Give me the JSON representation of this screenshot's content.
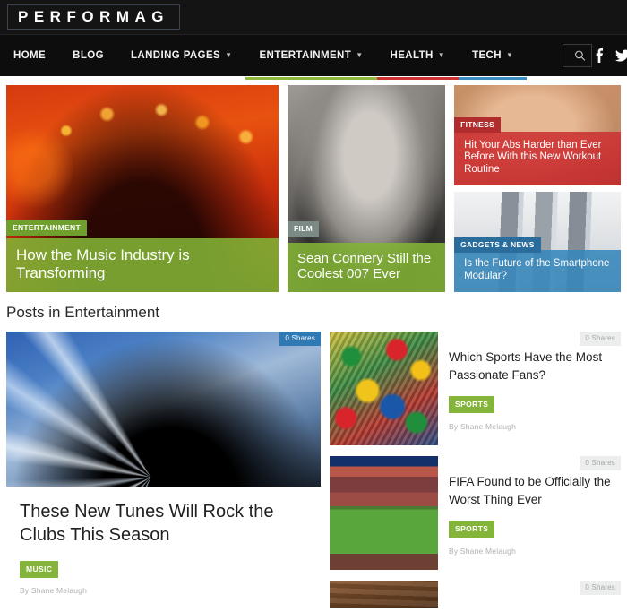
{
  "site": {
    "logo": "PERFORMAG"
  },
  "nav": {
    "items": [
      {
        "label": "HOME",
        "caret": false,
        "accent": ""
      },
      {
        "label": "BLOG",
        "caret": false,
        "accent": ""
      },
      {
        "label": "LANDING PAGES",
        "caret": true,
        "accent": ""
      },
      {
        "label": "ENTERTAINMENT",
        "caret": true,
        "accent": "#8cb93b"
      },
      {
        "label": "HEALTH",
        "caret": true,
        "accent": "#cd3334"
      },
      {
        "label": "TECH",
        "caret": true,
        "accent": "#3a8ec4"
      }
    ],
    "search": {
      "placeholder": "Search",
      "value": "",
      "icon": "search-icon"
    },
    "social": [
      {
        "name": "facebook-icon"
      },
      {
        "name": "twitter-icon"
      },
      {
        "name": "google-plus-icon"
      },
      {
        "name": "youtube-icon"
      }
    ]
  },
  "hero": {
    "featured": {
      "category": "ENTERTAINMENT",
      "title": "How the Music Industry is Transforming",
      "category_color": "#6f9f2c",
      "overlay_color": "#83b436"
    },
    "secondary": {
      "category": "FILM",
      "title": "Sean Connery Still the Coolest 007 Ever",
      "category_color": "#7c8a86",
      "overlay_color": "#83b436"
    },
    "side": [
      {
        "category": "FITNESS",
        "title": "Hit Your Abs Harder than Ever Before With this New Workout Routine",
        "category_color": "#b02c2d",
        "overlay_color": "#cd3334"
      },
      {
        "category": "GADGETS & NEWS",
        "title": "Is the Future of the Smartphone Modular?",
        "category_color": "#2a6c9c",
        "overlay_color": "#3486bb"
      }
    ]
  },
  "section": {
    "heading": "Posts in Entertainment"
  },
  "main_post": {
    "shares": "0 Shares",
    "title": "These New Tunes Will Rock the Clubs This Season",
    "tag": "MUSIC",
    "byline": "By Shane Melaugh"
  },
  "side_posts": [
    {
      "shares": "0 Shares",
      "title": "Which Sports Have the Most Passionate Fans?",
      "tag": "SPORTS",
      "byline": "By Shane Melaugh"
    },
    {
      "shares": "0 Shares",
      "title": "FIFA Found to be Officially the Worst Thing Ever",
      "tag": "SPORTS",
      "byline": "By Shane Melaugh"
    },
    {
      "shares": "0 Shares",
      "title": "",
      "tag": "",
      "byline": ""
    }
  ],
  "colors": {
    "green": "#84b53a",
    "red": "#cd3334",
    "blue": "#3486bb",
    "header_bg": "#141414",
    "nav_bg": "#0d0d0d"
  }
}
